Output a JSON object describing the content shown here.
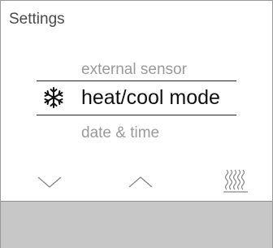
{
  "header": {
    "title": "Settings"
  },
  "menu": {
    "previous_item": "external sensor",
    "selected_item": "heat/cool mode",
    "next_item": "date & time"
  },
  "selected_icon": "snowflake-icon",
  "controls": {
    "down_icon": "chevron-down-icon",
    "up_icon": "chevron-up-icon",
    "heat_icon": "heating-waves-icon"
  },
  "colors": {
    "background": "#ffffff",
    "text_primary": "#111111",
    "text_dim": "#9a9a9a",
    "bottom_panel": "#c7c7c7"
  }
}
